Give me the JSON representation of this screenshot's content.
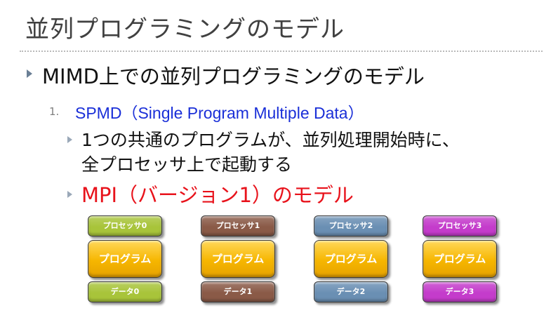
{
  "slide": {
    "title": "並列プログラミングのモデル",
    "heading": "MIMD上での並列プログラミングのモデル",
    "sub_number": "1.",
    "sub_heading": "SPMD（Single Program Multiple Data）",
    "point1_line1": "1つの共通のプログラムが、並列処理開始時に、",
    "point1_line2": "全プロセッサ上で起動する",
    "point2": "MPI（バージョン1）のモデル"
  },
  "diagram": {
    "columns": [
      {
        "processor": "プロセッサ0",
        "program": "プログラム",
        "data": "データ0",
        "color": "#a8c43a"
      },
      {
        "processor": "プロセッサ1",
        "program": "プログラム",
        "data": "データ1",
        "color": "#8a5a47"
      },
      {
        "processor": "プロセッサ2",
        "program": "プログラム",
        "data": "データ2",
        "color": "#6a8fb3"
      },
      {
        "processor": "プロセッサ3",
        "program": "プログラム",
        "data": "データ3",
        "color": "#c43ccb"
      }
    ]
  }
}
